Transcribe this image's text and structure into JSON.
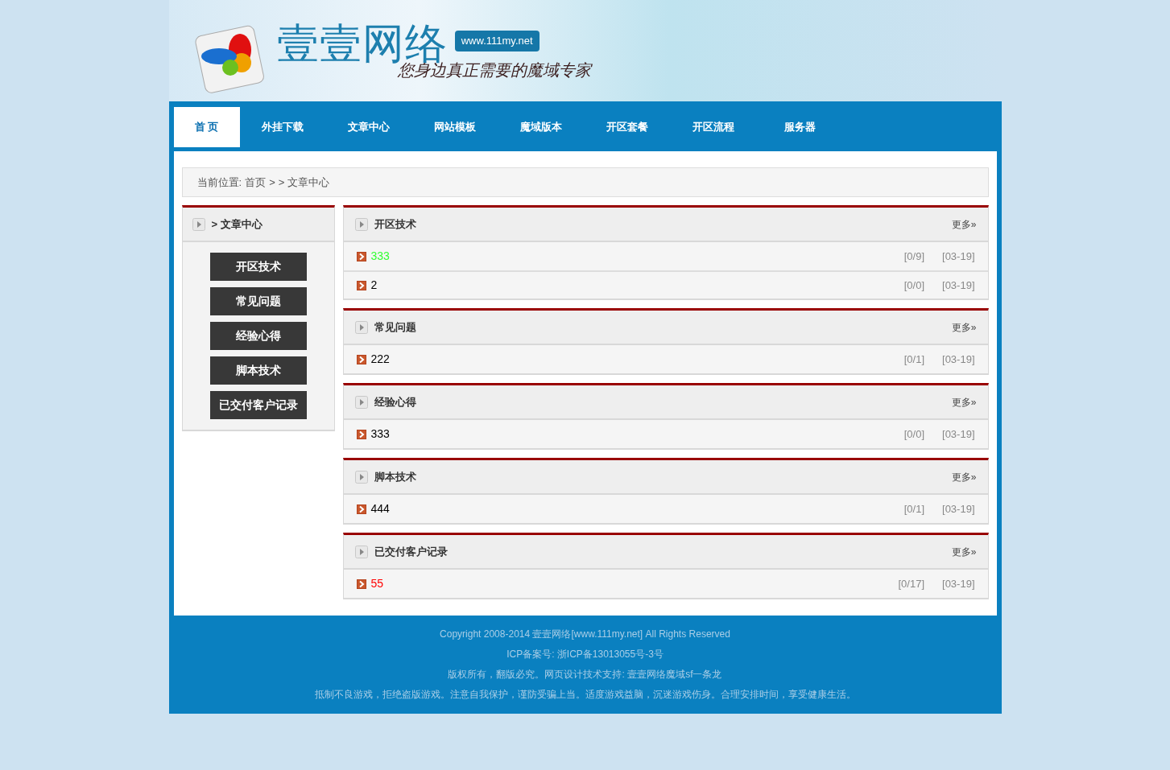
{
  "header": {
    "logo_text": "壹壹网络",
    "url_badge": "www.111my.net",
    "slogan": "您身边真正需要的魔域专家"
  },
  "nav": [
    {
      "label": "首 页",
      "selected": true
    },
    {
      "label": "外挂下载",
      "selected": false
    },
    {
      "label": "文章中心",
      "selected": false
    },
    {
      "label": "网站模板",
      "selected": false
    },
    {
      "label": "魔域版本",
      "selected": false
    },
    {
      "label": "开区套餐",
      "selected": false
    },
    {
      "label": "开区流程",
      "selected": false
    },
    {
      "label": "服务器",
      "selected": false
    }
  ],
  "breadcrumb": {
    "label": "当前位置:",
    "items": [
      "首页",
      ">",
      ">",
      "文章中心"
    ]
  },
  "sidebar": {
    "title": "> 文章中心",
    "items": [
      "开区技术",
      "常见问题",
      "经验心得",
      "脚本技术",
      "已交付客户记录"
    ]
  },
  "sections": [
    {
      "title": "开区技术",
      "more": "更多»",
      "articles": [
        {
          "title": "333",
          "color": "#33ff33",
          "count": "[0/9]",
          "date": "[03-19]"
        },
        {
          "title": "2",
          "color": "#000000",
          "count": "[0/0]",
          "date": "[03-19]"
        }
      ]
    },
    {
      "title": "常见问题",
      "more": "更多»",
      "articles": [
        {
          "title": "222",
          "color": "#000000",
          "count": "[0/1]",
          "date": "[03-19]"
        }
      ]
    },
    {
      "title": "经验心得",
      "more": "更多»",
      "articles": [
        {
          "title": "333",
          "color": "#000000",
          "count": "[0/0]",
          "date": "[03-19]"
        }
      ]
    },
    {
      "title": "脚本技术",
      "more": "更多»",
      "articles": [
        {
          "title": "444",
          "color": "#000000",
          "count": "[0/1]",
          "date": "[03-19]"
        }
      ]
    },
    {
      "title": "已交付客户记录",
      "more": "更多»",
      "articles": [
        {
          "title": "55",
          "color": "#ff0000",
          "count": "[0/17]",
          "date": "[03-19]"
        }
      ]
    }
  ],
  "footer": [
    "Copyright 2008-2014 壹壹网络[www.111my.net] All Rights Reserved",
    "ICP备案号: 浙ICP备13013055号-3号",
    "版权所有，翻版必究。网页设计技术支持: 壹壹网络魔域sf一条龙",
    "抵制不良游戏，拒绝盗版游戏。注意自我保护，谨防受骗上当。适度游戏益脑，沉迷游戏伤身。合理安排时间，享受健康生活。"
  ]
}
